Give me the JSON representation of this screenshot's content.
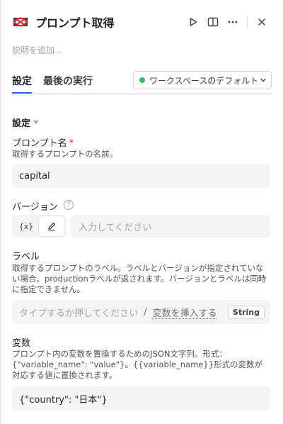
{
  "header": {
    "title": "プロンプト取得",
    "icons": [
      "logo-icon",
      "play-icon",
      "split-view-icon",
      "more-icon",
      "close-icon"
    ]
  },
  "description_placeholder": "説明を追加...",
  "tabs": [
    {
      "label": "設定",
      "active": true
    },
    {
      "label": "最後の実行",
      "active": false
    }
  ],
  "workspace_select": {
    "label": "ワークスペースのデフォルト",
    "status_color": "#22c55e"
  },
  "section": {
    "title": "設定"
  },
  "prompt_name": {
    "label": "プロンプト名",
    "required_mark": "*",
    "help": "取得するプロンプトの名前。",
    "value": "capital"
  },
  "version": {
    "label": "バージョン",
    "help_mark": "?",
    "mode_expression": "{x}",
    "placeholder": "入力してください"
  },
  "label_field": {
    "label": "ラベル",
    "help": "取得するプロンプトのラベル。ラベルとバージョンが指定されていない場合、productionラベルが返されます。バージョンとラベルは同時に指定できません。",
    "placeholder": "タイプするか押してください",
    "slash": "/",
    "insert_variable": "変数を挿入する",
    "type_badge": "String"
  },
  "variables": {
    "label": "変数",
    "help": "プロンプト内の変数を置換するためのJSON文字列。形式：{\"variable_name\": \"value\"}。{{variable_name}}形式の変数が対応する値に置換されます。",
    "value": "{\"country\": \"日本\"}"
  },
  "colors": {
    "accent": "#2563eb",
    "required": "#dc2626",
    "field_bg": "#f4f4f5"
  }
}
